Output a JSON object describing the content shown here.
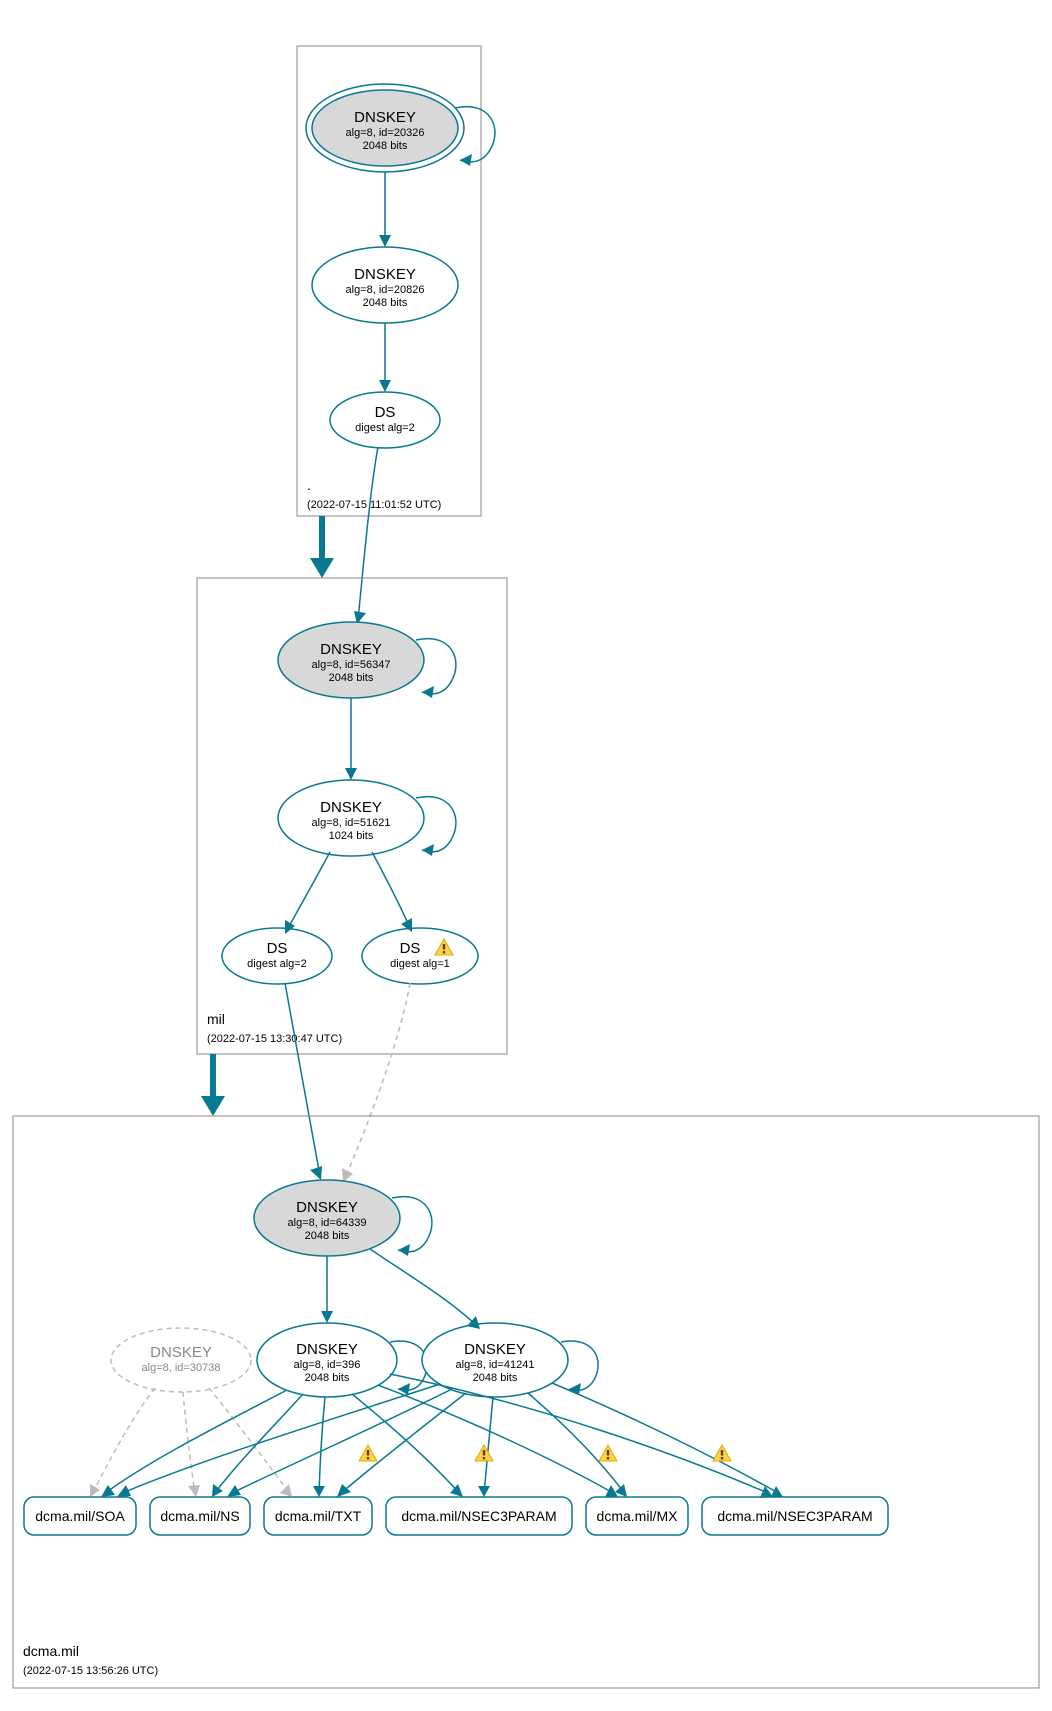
{
  "zones": {
    "root": {
      "name": ".",
      "timestamp": "(2022-07-15 11:01:52 UTC)",
      "nodes": {
        "ksk": {
          "title": "DNSKEY",
          "sub1": "alg=8, id=20326",
          "sub2": "2048 bits"
        },
        "zsk": {
          "title": "DNSKEY",
          "sub1": "alg=8, id=20826",
          "sub2": "2048 bits"
        },
        "ds": {
          "title": "DS",
          "sub1": "digest alg=2"
        }
      }
    },
    "mil": {
      "name": "mil",
      "timestamp": "(2022-07-15 13:30:47 UTC)",
      "nodes": {
        "ksk": {
          "title": "DNSKEY",
          "sub1": "alg=8, id=56347",
          "sub2": "2048 bits"
        },
        "zsk": {
          "title": "DNSKEY",
          "sub1": "alg=8, id=51621",
          "sub2": "1024 bits"
        },
        "ds1": {
          "title": "DS",
          "sub1": "digest alg=2"
        },
        "ds2": {
          "title": "DS",
          "sub1": "digest alg=1"
        }
      }
    },
    "dcma": {
      "name": "dcma.mil",
      "timestamp": "(2022-07-15 13:56:26 UTC)",
      "nodes": {
        "ksk": {
          "title": "DNSKEY",
          "sub1": "alg=8, id=64339",
          "sub2": "2048 bits"
        },
        "zsk1": {
          "title": "DNSKEY",
          "sub1": "alg=8, id=396",
          "sub2": "2048 bits"
        },
        "zsk2": {
          "title": "DNSKEY",
          "sub1": "alg=8, id=41241",
          "sub2": "2048 bits"
        },
        "stale": {
          "title": "DNSKEY",
          "sub1": "alg=8, id=30738"
        }
      },
      "records": {
        "soa": "dcma.mil/SOA",
        "ns": "dcma.mil/NS",
        "txt": "dcma.mil/TXT",
        "n3a": "dcma.mil/NSEC3PARAM",
        "mx": "dcma.mil/MX",
        "n3b": "dcma.mil/NSEC3PARAM"
      }
    }
  },
  "colors": {
    "teal": "#087990",
    "grey": "#bbb",
    "ksk_fill": "#d8d8d8"
  },
  "icon": {
    "warn": "⚠"
  }
}
